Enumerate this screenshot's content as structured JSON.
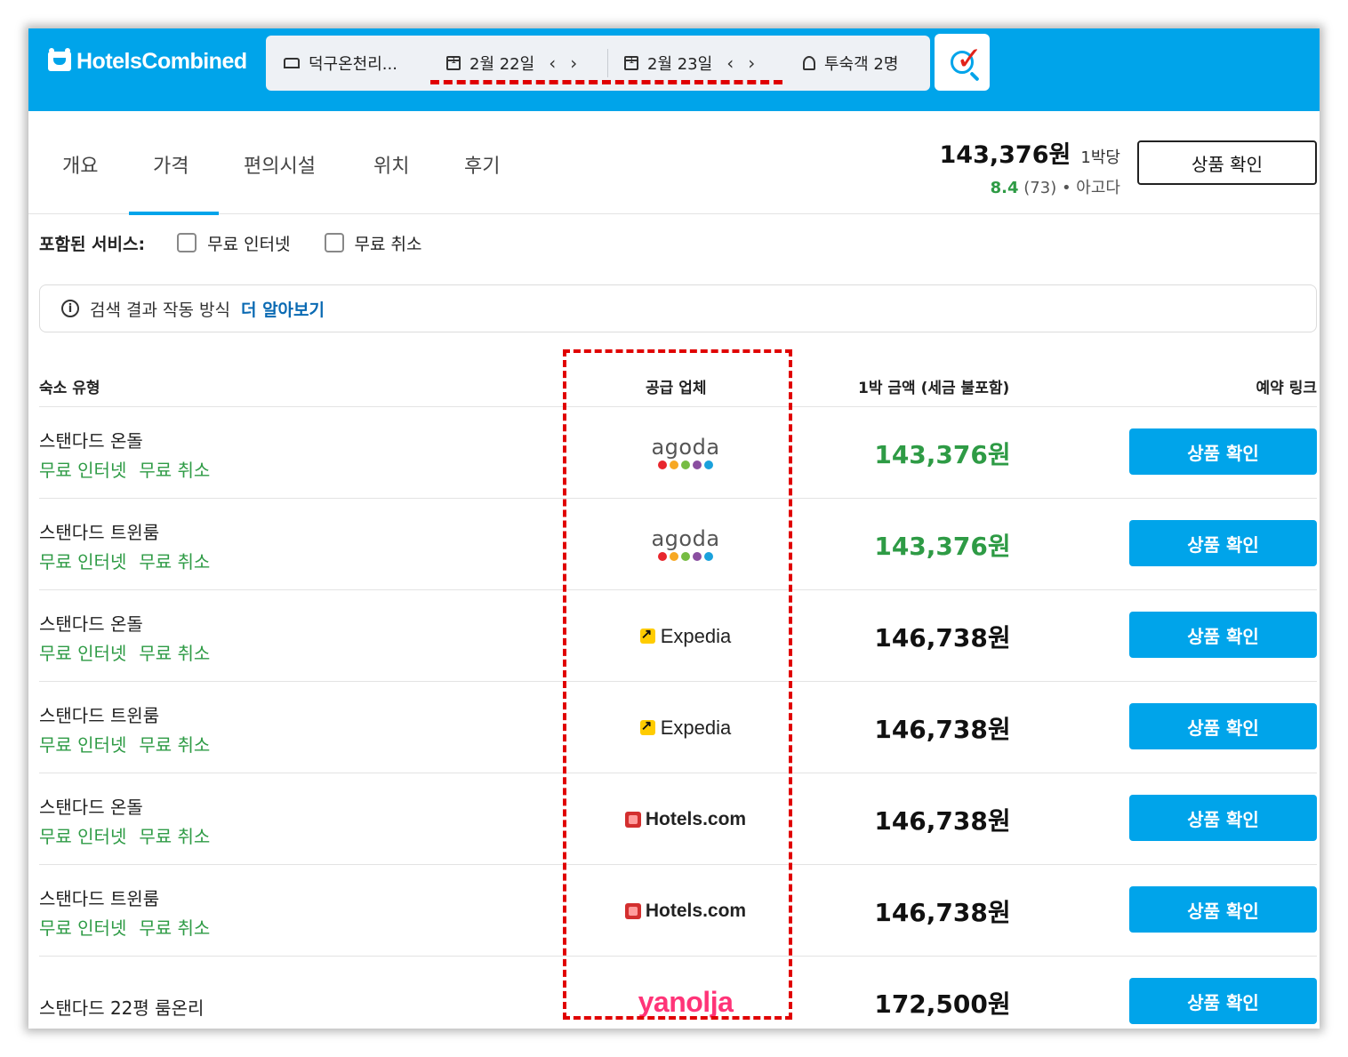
{
  "header": {
    "brand": "HotelsCombined",
    "search": {
      "destination": "덕구온천리...",
      "checkin": "2월 22일",
      "checkout": "2월 23일",
      "guests": "투숙객 2명"
    }
  },
  "tabs": [
    "개요",
    "가격",
    "편의시설",
    "위치",
    "후기"
  ],
  "active_tab": "가격",
  "summary": {
    "price": "143,376원",
    "unit": "1박당",
    "score": "8.4",
    "reviews": "(73)",
    "source": "• 아고다",
    "button": "상품 확인"
  },
  "filters": {
    "label": "포함된 서비스:",
    "options": [
      "무료 인터넷",
      "무료 취소"
    ]
  },
  "info": {
    "text": "검색 결과 작동 방식",
    "link": "더 알아보기"
  },
  "table": {
    "headers": [
      "숙소 유형",
      "공급 업체",
      "1박 금액 (세금 불포함)",
      "예약 링크"
    ],
    "rows": [
      {
        "room": "스탠다드 온돌",
        "tags": [
          "무료 인터넷",
          "무료 취소"
        ],
        "vendor": "agoda",
        "price": "143,376원",
        "best": true,
        "button": "상품 확인"
      },
      {
        "room": "스탠다드 트윈룸",
        "tags": [
          "무료 인터넷",
          "무료 취소"
        ],
        "vendor": "agoda",
        "price": "143,376원",
        "best": true,
        "button": "상품 확인"
      },
      {
        "room": "스탠다드 온돌",
        "tags": [
          "무료 인터넷",
          "무료 취소"
        ],
        "vendor": "Expedia",
        "price": "146,738원",
        "best": false,
        "button": "상품 확인"
      },
      {
        "room": "스탠다드 트윈룸",
        "tags": [
          "무료 인터넷",
          "무료 취소"
        ],
        "vendor": "Expedia",
        "price": "146,738원",
        "best": false,
        "button": "상품 확인"
      },
      {
        "room": "스탠다드 온돌",
        "tags": [
          "무료 인터넷",
          "무료 취소"
        ],
        "vendor": "Hotels.com",
        "price": "146,738원",
        "best": false,
        "button": "상품 확인"
      },
      {
        "room": "스탠다드 트윈룸",
        "tags": [
          "무료 인터넷",
          "무료 취소"
        ],
        "vendor": "Hotels.com",
        "price": "146,738원",
        "best": false,
        "button": "상품 확인"
      },
      {
        "room": "스탠다드 22평 룸온리",
        "tags": [],
        "vendor": "yanolja",
        "price": "172,500원",
        "best": false,
        "button": "상품 확인"
      }
    ]
  },
  "colors": {
    "brand_blue": "#00a4ea",
    "best_price_green": "#2e9b45",
    "highlight_red": "#e00000",
    "agoda_dots": [
      "#e8262d",
      "#f7a823",
      "#76bc43",
      "#8a4ea0",
      "#1aa1dc"
    ]
  }
}
